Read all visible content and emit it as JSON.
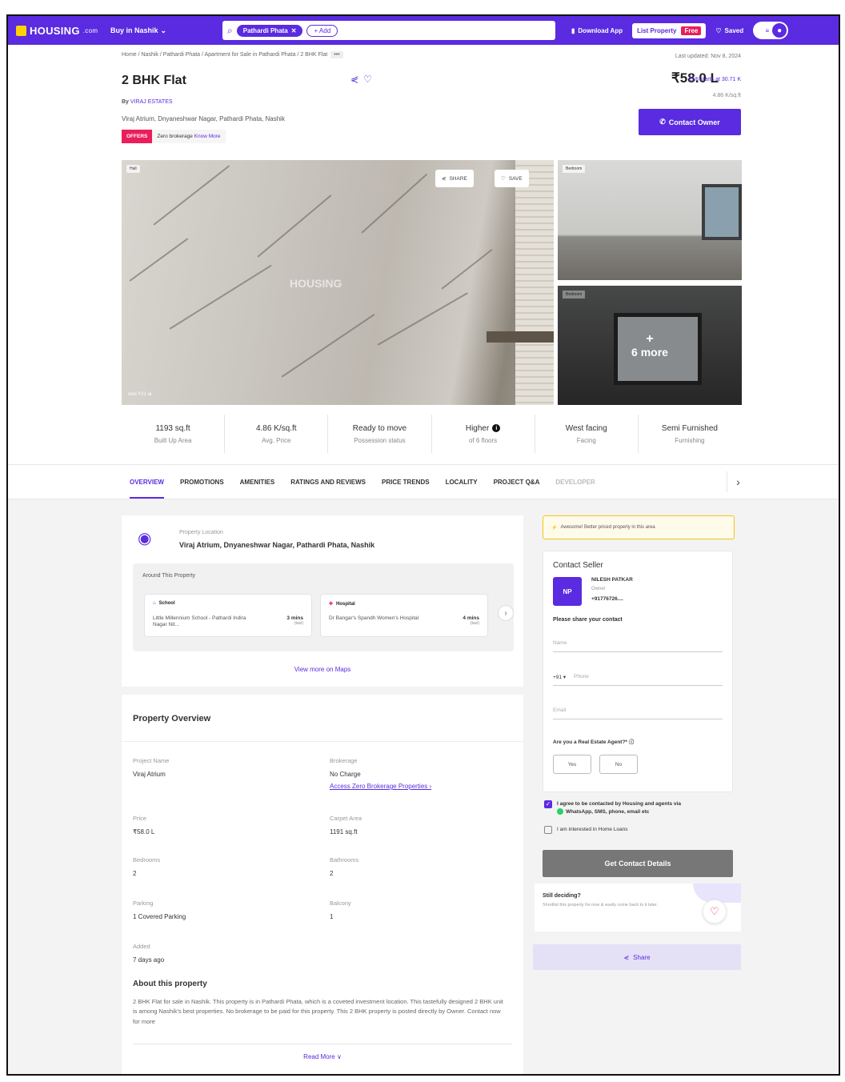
{
  "header": {
    "logo": "HOUSING",
    "logo_domain": ".com",
    "city": "Buy in Nashik",
    "search_chip": "Pathardi Phata",
    "search_add": "+ Add",
    "download_app": "Download App",
    "list_property": "List Property",
    "free_badge": "Free",
    "saved": "Saved"
  },
  "breadcrumb": {
    "text": "Home / Nashik / Pathardi Phata / Apartment for Sale in Pathardi Phata / 2 BHK Flat",
    "more": "•••"
  },
  "last_updated": "Last updated: Nov 8, 2024",
  "listing": {
    "title": "2 BHK Flat",
    "by_label": "By",
    "by_name": "VIRAJ ESTATES",
    "address": "Viraj Atrium, Dnyaneshwar Nagar, Pathardi Phata, Nashik",
    "offers_tag": "OFFERS",
    "offers_text": "Zero brokerage",
    "offers_link": "Know More",
    "price": "₹58.0 L",
    "emi": "EMI starts at 30.71 K",
    "per_sqft": "4.86 K/sq.ft",
    "contact_owner": "Contact Owner"
  },
  "gallery": {
    "main_tag": "Hall",
    "watermark": "HOUSING",
    "share": "SHARE",
    "save": "SAVE",
    "shot_text": "vivo Y21 ai",
    "side1_tag": "Bedroom",
    "side2_tag": "Bedroom",
    "more_plus": "+",
    "more_label": "6 more"
  },
  "stats": [
    {
      "value": "1193 sq.ft",
      "key": "Built Up Area"
    },
    {
      "value": "4.86 K/sq.ft",
      "key": "Avg. Price"
    },
    {
      "value": "Ready to move",
      "key": "Possession status"
    },
    {
      "value": "Higher",
      "key": "of 6 floors"
    },
    {
      "value": "West facing",
      "key": "Facing"
    },
    {
      "value": "Semi Furnished",
      "key": "Furnishing"
    }
  ],
  "tabs": [
    "OVERVIEW",
    "PROMOTIONS",
    "AMENITIES",
    "RATINGS AND REVIEWS",
    "PRICE TRENDS",
    "LOCALITY",
    "PROJECT Q&A",
    "DEVELOPER"
  ],
  "location": {
    "label": "Property Location",
    "value": "Viraj Atrium, Dnyaneshwar Nagar, Pathardi Phata, Nashik",
    "around_heading": "Around This Property",
    "pois": [
      {
        "category": "School",
        "name": "Little Millennium School - Pathardi Indira Nagar Nit...",
        "distance": "3 mins",
        "mode": "(taxi)"
      },
      {
        "category": "Hospital",
        "name": "Dr Bangar's Spandh Women's Hospital",
        "distance": "4 mins",
        "mode": "(taxi)"
      }
    ],
    "view_maps": "View more on Maps"
  },
  "overview": {
    "title": "Property Overview",
    "project_name_k": "Project Name",
    "project_name_v": "Viraj Atrium",
    "brokerage_k": "Brokerage",
    "brokerage_v": "No Charge",
    "brokerage_link": "Access Zero Brokerage Properties ›",
    "price_k": "Price",
    "price_v": "₹58.0 L",
    "carpet_k": "Carpet Area",
    "carpet_v": "1191 sq.ft",
    "bedrooms_k": "Bedrooms",
    "bedrooms_v": "2",
    "bathrooms_k": "Bathrooms",
    "bathrooms_v": "2",
    "parking_k": "Parking",
    "parking_v": "1 Covered Parking",
    "balcony_k": "Balcony",
    "balcony_v": "1",
    "added_k": "Added",
    "added_v": "7 days ago",
    "about_h": "About this property",
    "about_t": "2 BHK Flat for sale in Nashik. This property is in Pathardi Phata, which is a coveted investment location. This tastefully designed 2 BHK unit is among Nashik's best properties. No brokerage to be paid for this property. This 2 BHK property is posted directly by Owner. Contact now for more",
    "read_more": "Read More ∨"
  },
  "sidebar": {
    "banner": "Awesome! Better priced property in this area",
    "contact_heading": "Contact Seller",
    "seller_initials": "NP",
    "seller_name": "NILESH PATKAR",
    "seller_role": "Owner",
    "seller_phone": "+91776726....",
    "share_contact": "Please share your contact",
    "name_placeholder": "Name",
    "country_code": "+91 ▾",
    "phone_placeholder": "Phone",
    "email_placeholder": "Email",
    "agent_question": "Are you a Real Estate Agent?* ⓘ",
    "yes": "Yes",
    "no": "No",
    "agree_text": "I agree to be contacted by Housing and agents via",
    "agree_text2": "WhatsApp, SMS, phone, email etc",
    "home_loans": "I am interested in Home Loans",
    "get_contact": "Get Contact Details",
    "still_deciding": "Still deciding?",
    "still_text": "Shortlist this property for now & easily come back to it later.",
    "share": "Share"
  },
  "colors": {
    "brand": "#5a2be0",
    "accent_pink": "#e91e5a"
  }
}
